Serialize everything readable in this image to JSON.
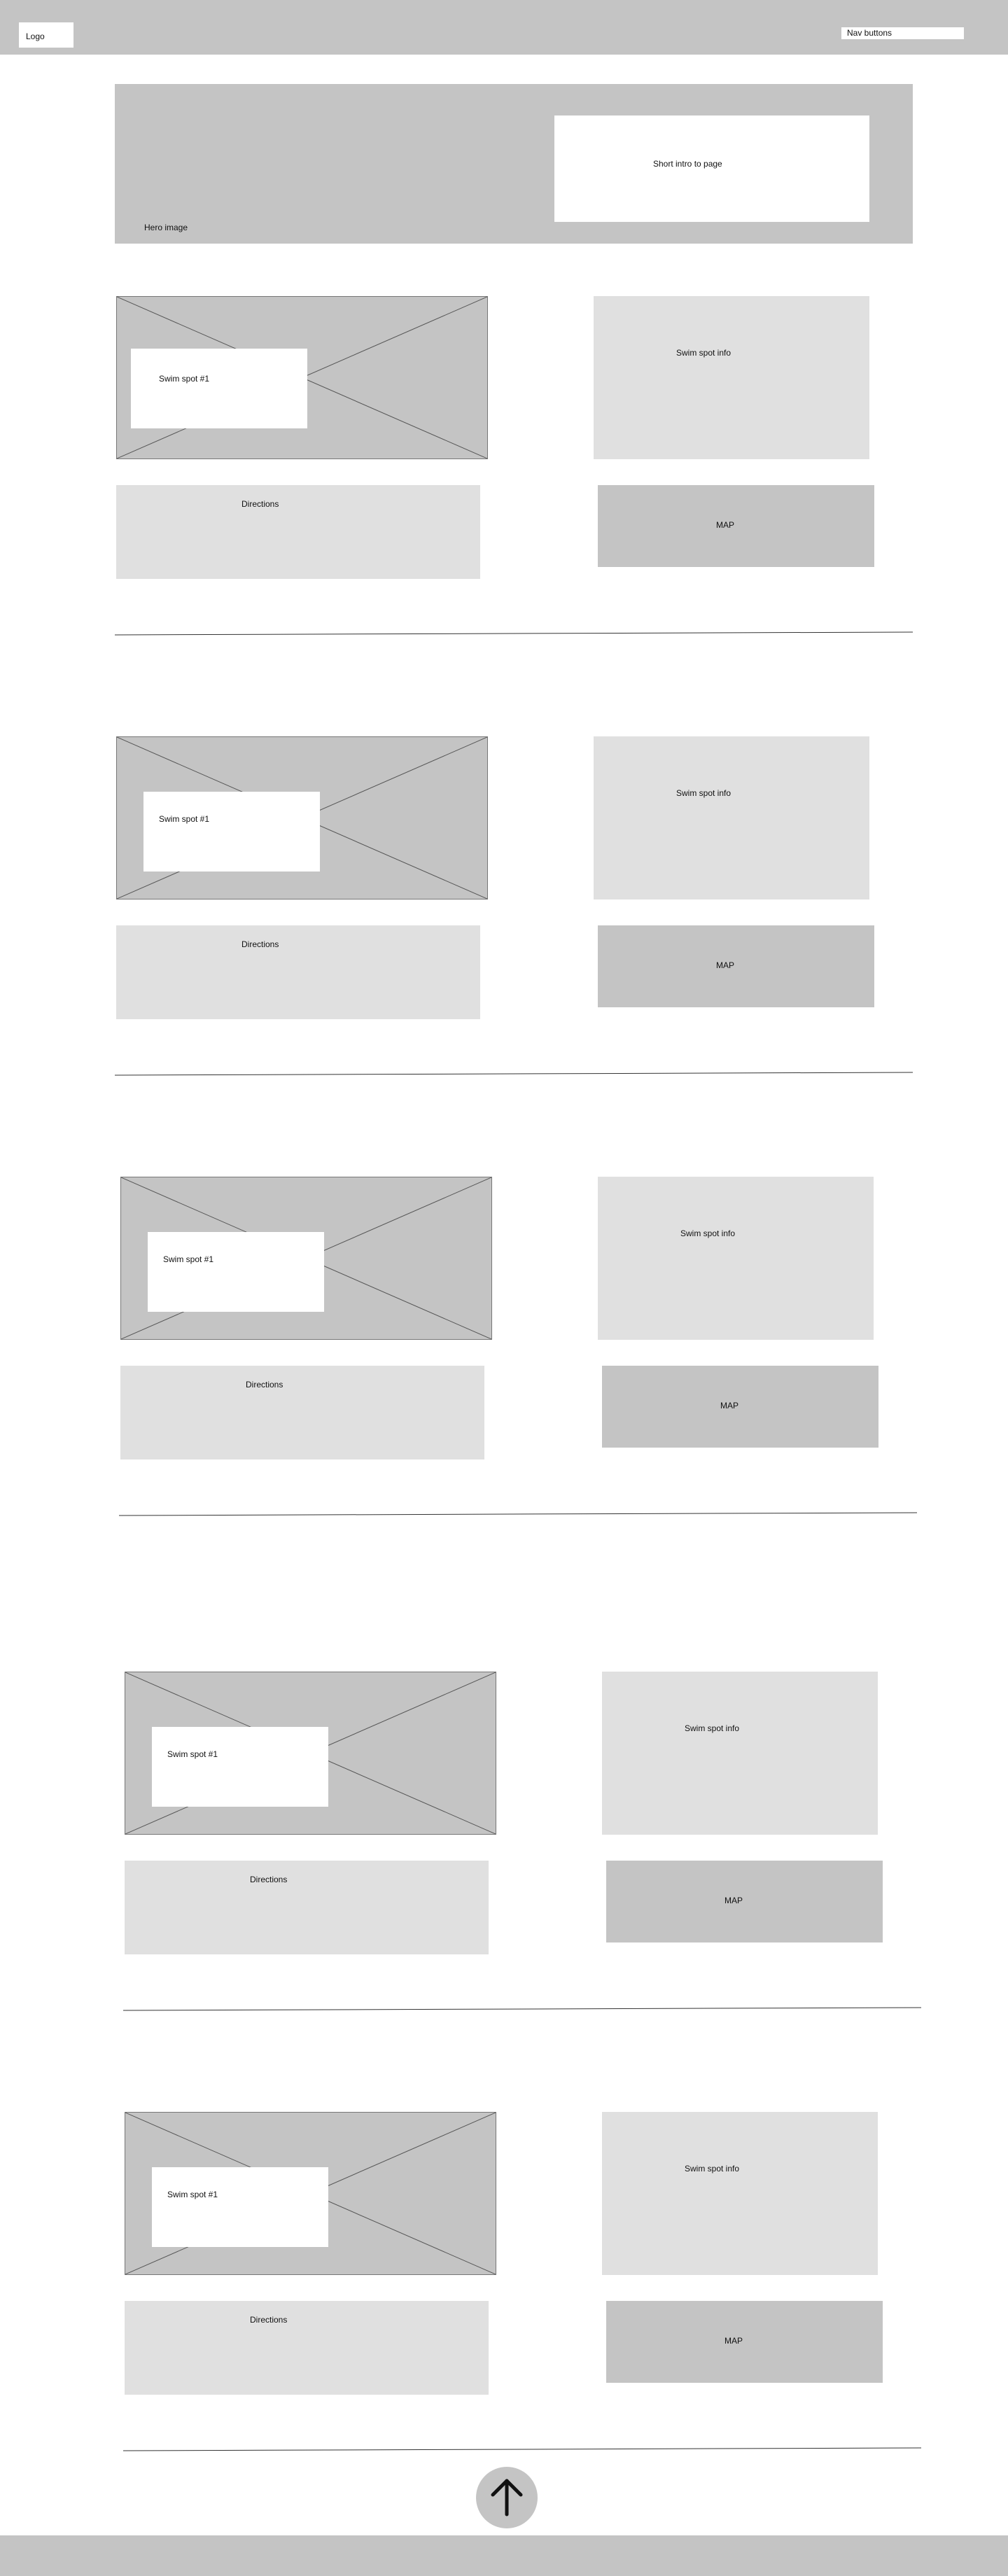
{
  "header": {
    "logo_label": "Logo",
    "nav_label": "Nav buttons"
  },
  "hero": {
    "image_label": "Hero image",
    "intro_label": "Short intro to page"
  },
  "spots": [
    {
      "title": "Swim spot #1",
      "info": "Swim spot info",
      "directions": "Directions",
      "map": "MAP"
    },
    {
      "title": "Swim spot #1",
      "info": "Swim spot info",
      "directions": "Directions",
      "map": "MAP"
    },
    {
      "title": "Swim spot #1",
      "info": "Swim spot info",
      "directions": "Directions",
      "map": "MAP"
    },
    {
      "title": "Swim spot #1",
      "info": "Swim spot info",
      "directions": "Directions",
      "map": "MAP"
    },
    {
      "title": "Swim spot #1",
      "info": "Swim spot info",
      "directions": "Directions",
      "map": "MAP"
    }
  ],
  "footer": {
    "back_to_top_icon": "arrow-up-icon"
  },
  "colors": {
    "placeholder_dark": "#c4c4c4",
    "placeholder_light": "#e0e0e0",
    "background": "#ffffff"
  }
}
